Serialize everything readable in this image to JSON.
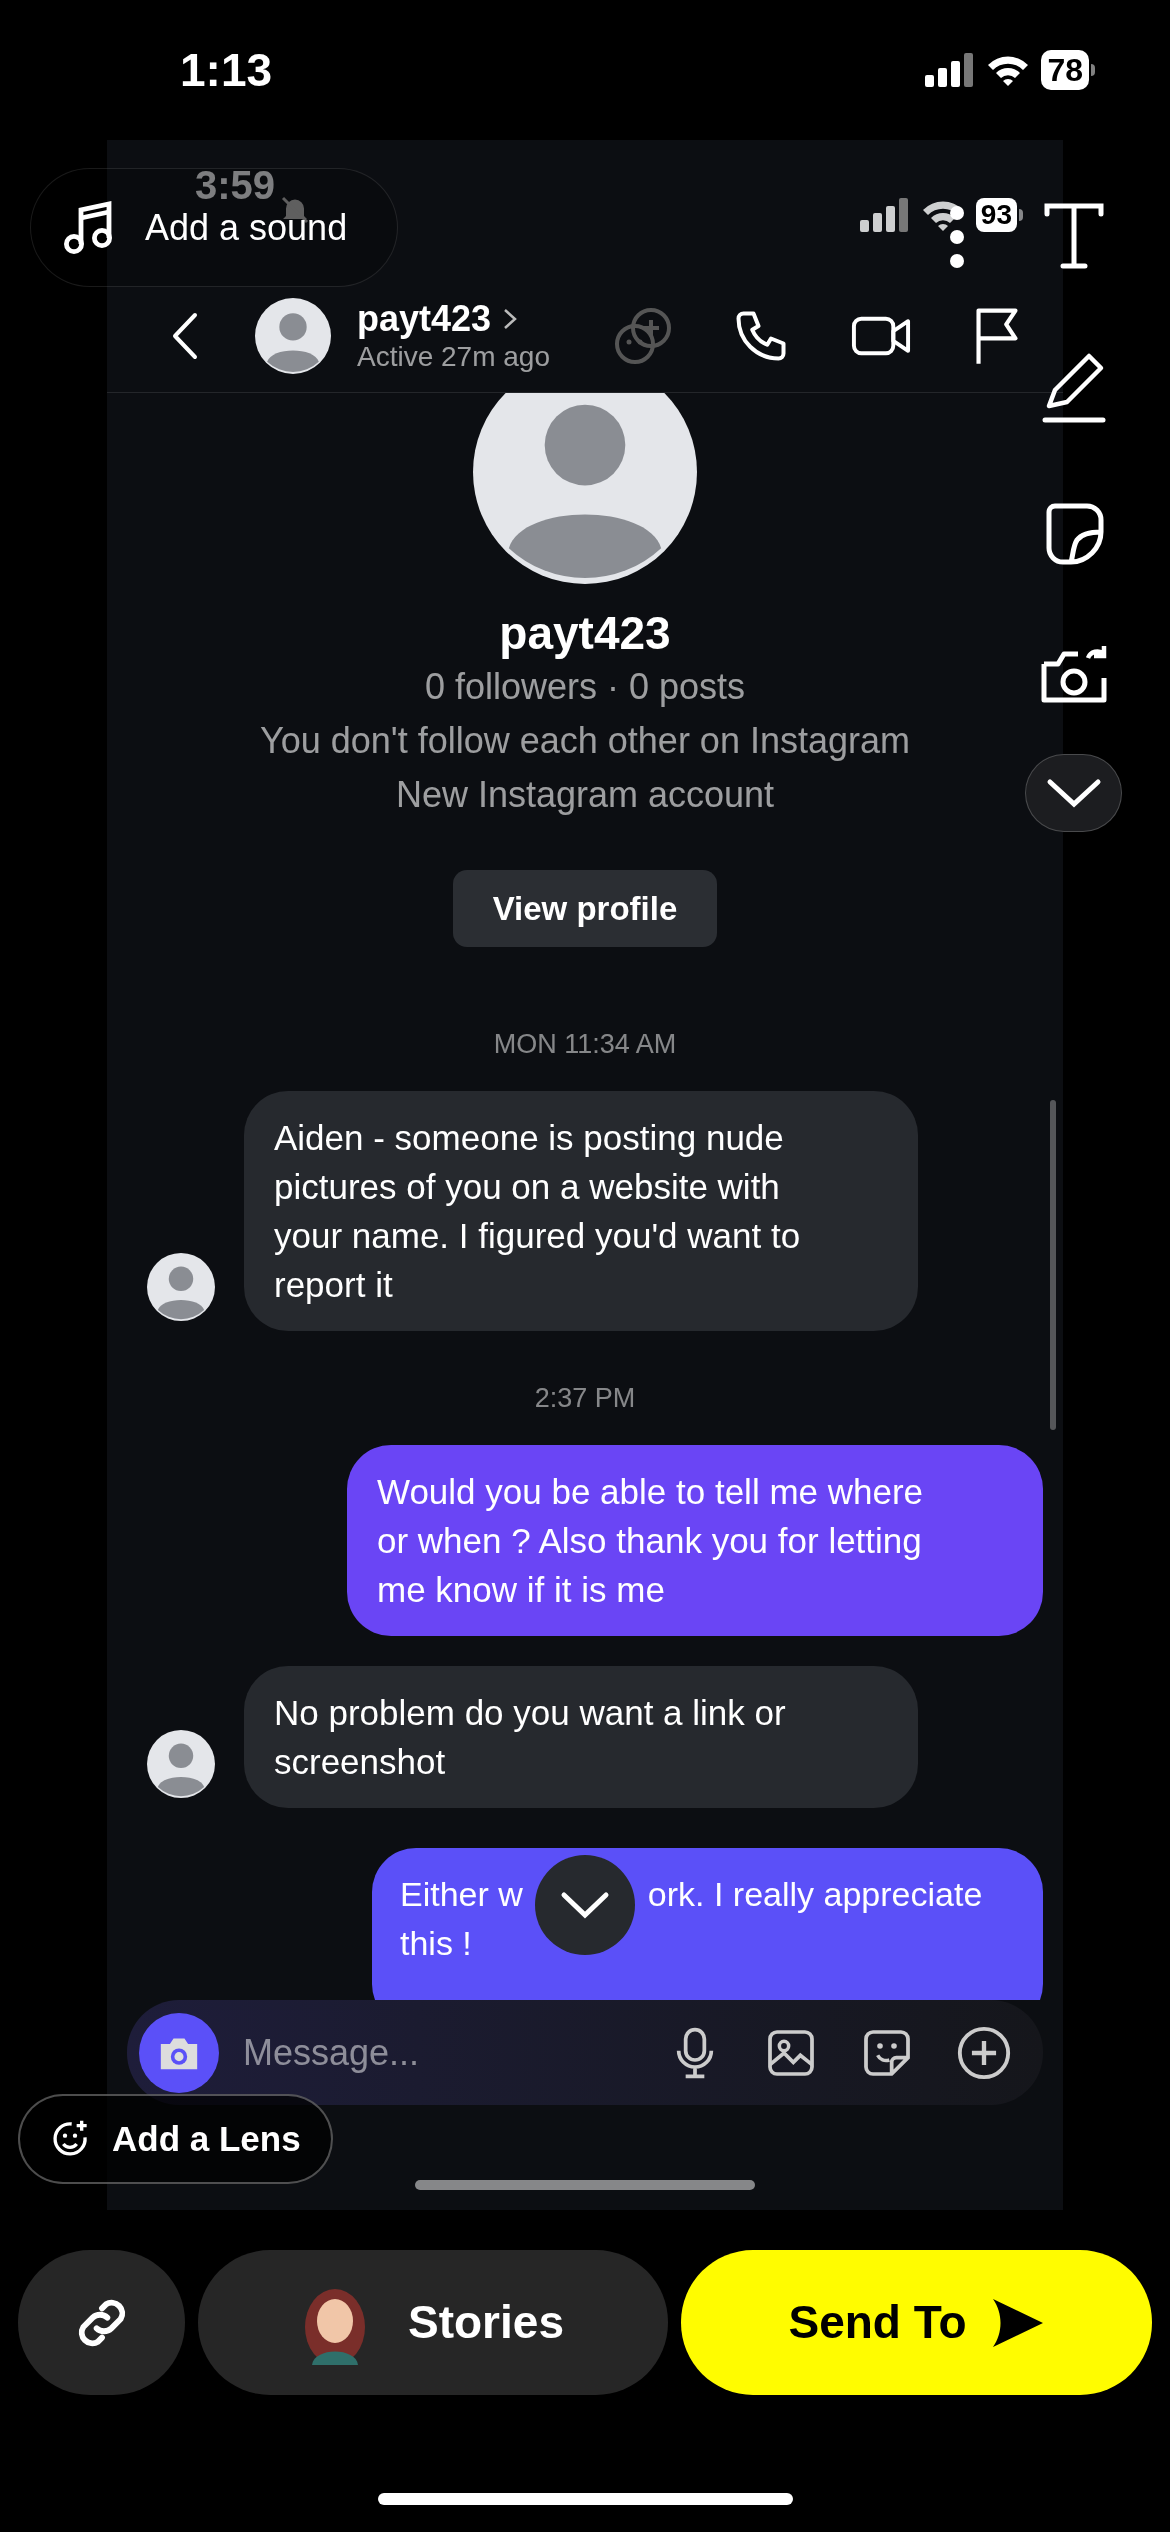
{
  "status_bar": {
    "time": "1:13",
    "battery": "78"
  },
  "editor": {
    "add_sound": "Add a sound",
    "add_lens": "Add a Lens"
  },
  "screenshot": {
    "status_bar": {
      "time": "3:59",
      "battery": "93"
    },
    "header": {
      "username": "payt423",
      "activity": "Active 27m ago"
    },
    "profile": {
      "username": "payt423",
      "stats": "0 followers · 0 posts",
      "relation": "You don't follow each other on Instagram",
      "note": "New Instagram account",
      "button": "View profile"
    },
    "thread": [
      {
        "kind": "timestamp",
        "text": "MON 11:34 AM"
      },
      {
        "kind": "received",
        "text": "Aiden - someone is posting nude pictures of you on a website with your name. I figured you'd want to report it"
      },
      {
        "kind": "timestamp",
        "text": "2:37 PM"
      },
      {
        "kind": "sent",
        "text": "Would you be able to tell me where or when ? Also thank you for letting me know if it is me"
      },
      {
        "kind": "received",
        "text": "No problem do you want a link or screenshot"
      },
      {
        "kind": "sent_covered",
        "parts": [
          "Either w",
          "ork. I really appreciate this !"
        ]
      }
    ],
    "composer": {
      "placeholder": "Message..."
    }
  },
  "bottom_bar": {
    "stories": "Stories",
    "send": "Send To"
  }
}
